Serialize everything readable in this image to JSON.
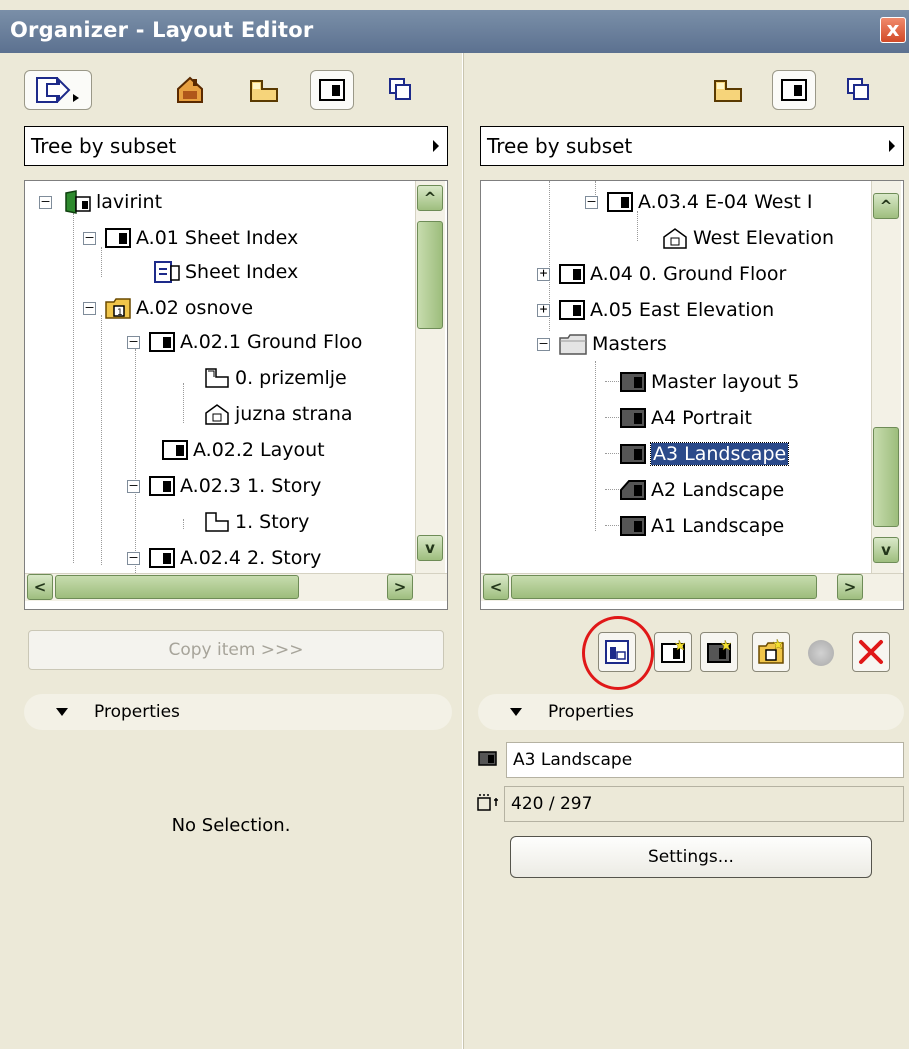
{
  "window": {
    "title": "Organizer - Layout Editor",
    "close_label": "x"
  },
  "left": {
    "dropdown": "Tree by subset",
    "tree": [
      {
        "label": "lavirint",
        "icon": "project-icon"
      },
      {
        "label": "A.01 Sheet Index",
        "icon": "layout-icon"
      },
      {
        "label": "Sheet Index",
        "icon": "index-icon"
      },
      {
        "label": "A.02 osnove",
        "icon": "subset-folder-icon"
      },
      {
        "label": "A.02.1 Ground Floo",
        "icon": "layout-icon"
      },
      {
        "label": "0. prizemlje",
        "icon": "floorplan-icon"
      },
      {
        "label": "juzna strana",
        "icon": "elevation-icon"
      },
      {
        "label": "A.02.2 Layout",
        "icon": "layout-icon"
      },
      {
        "label": "A.02.3 1. Story",
        "icon": "layout-icon"
      },
      {
        "label": "1. Story",
        "icon": "floorplan-icon"
      },
      {
        "label": "A.02.4 2. Story",
        "icon": "layout-icon"
      }
    ],
    "copy_button": "Copy item >>>",
    "properties_label": "Properties",
    "no_selection": "No Selection."
  },
  "right": {
    "dropdown": "Tree by subset",
    "tree": [
      {
        "label": "A.03.4 E-04 West I",
        "icon": "layout-icon"
      },
      {
        "label": "West Elevation",
        "icon": "elevation-icon"
      },
      {
        "label": "A.04 0. Ground Floor",
        "icon": "layout-icon"
      },
      {
        "label": "A.05 East Elevation",
        "icon": "layout-icon"
      },
      {
        "label": "Masters",
        "icon": "folder-icon"
      },
      {
        "label": "Master layout 5",
        "icon": "master-icon"
      },
      {
        "label": "A4 Portrait",
        "icon": "master-icon"
      },
      {
        "label": "A3 Landscape",
        "icon": "master-icon",
        "selected": true
      },
      {
        "label": "A2 Landscape",
        "icon": "master-icon"
      },
      {
        "label": "A1 Landscape",
        "icon": "master-icon"
      }
    ],
    "properties_label": "Properties",
    "name_value": "A3 Landscape",
    "size_value": "420 / 297",
    "settings_button": "Settings..."
  },
  "colors": {
    "selection": "#2b4a8a",
    "title_bar": "#5c7190",
    "highlight_circle": "#e01818",
    "delete": "#e01818"
  }
}
